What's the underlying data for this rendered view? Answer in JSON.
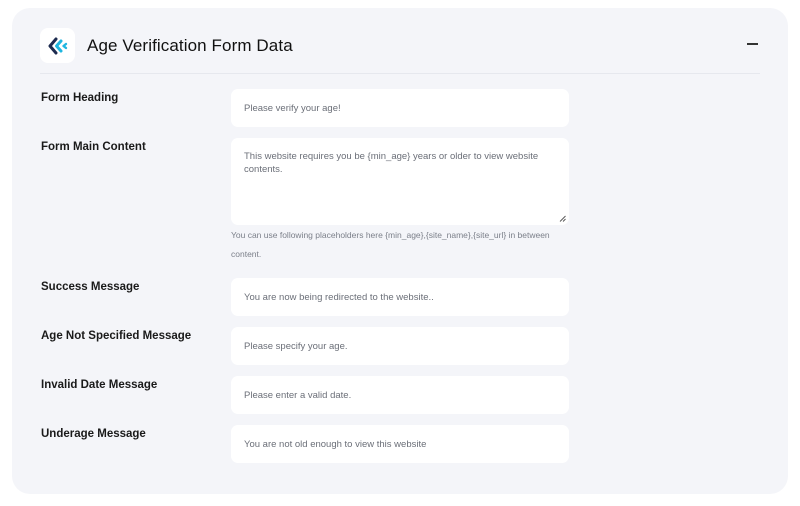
{
  "header": {
    "title": "Age Verification Form Data"
  },
  "icons": {
    "logo": "brand-logo-icon",
    "collapse": "minus-icon",
    "resize": "resize-grip-icon"
  },
  "colors": {
    "brand_dark": "#1d2b4f",
    "brand_light": "#1fb6e0",
    "panel_bg": "#f4f5f9"
  },
  "fields": {
    "form_heading": {
      "label": "Form Heading",
      "value": "Please verify your age!"
    },
    "form_main_content": {
      "label": "Form Main Content",
      "value": "This website requires you be {min_age} years or older to view website contents.",
      "help": "You can use following placeholders here {min_age},{site_name},{site_url} in between content."
    },
    "success_message": {
      "label": "Success Message",
      "value": "You are now being redirected to the website.."
    },
    "age_not_specified_message": {
      "label": "Age Not Specified Message",
      "value": "Please specify your age."
    },
    "invalid_date_message": {
      "label": "Invalid Date Message",
      "value": "Please enter a valid date."
    },
    "underage_message": {
      "label": "Underage Message",
      "value": "You are not old enough to view this website"
    }
  }
}
